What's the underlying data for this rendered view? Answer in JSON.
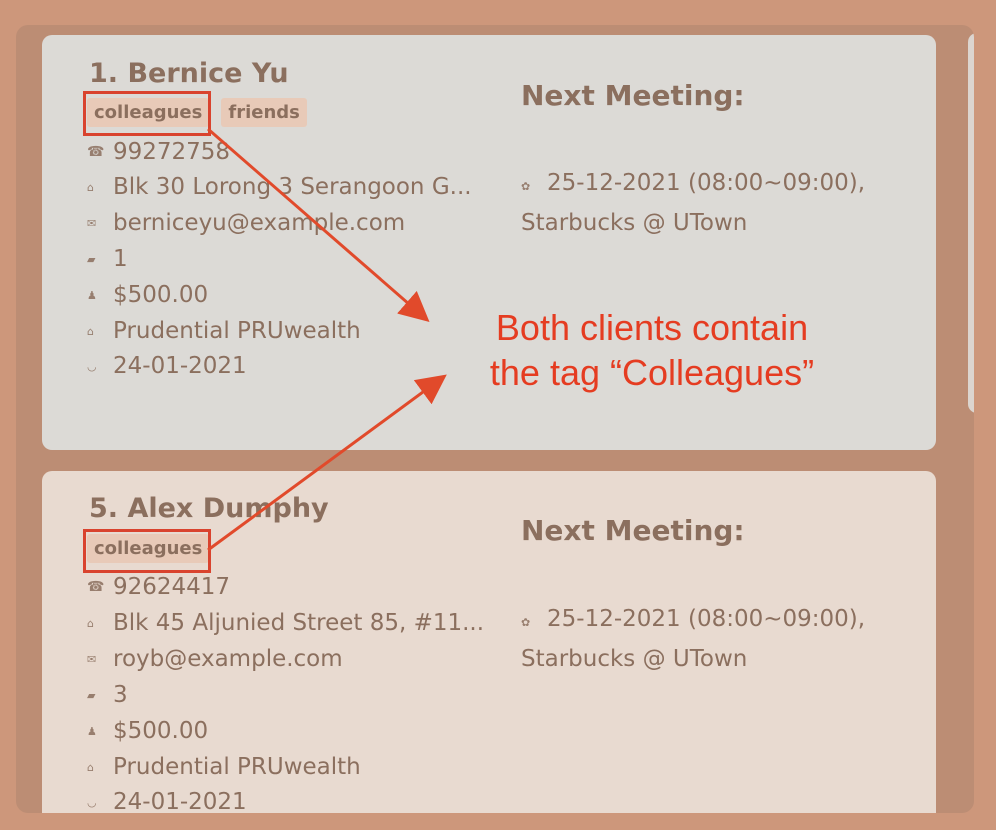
{
  "clients": [
    {
      "name": "1.  Bernice Yu",
      "tags": [
        "colleagues",
        "friends"
      ],
      "phone": "99272758",
      "address": "Blk 30 Lorong 3 Serangoon G...",
      "email": "berniceyu@example.com",
      "risk": "1",
      "income": "$500.00",
      "plan": "Prudential PRUwealth",
      "date": "24-01-2021",
      "next_meeting_label": "Next Meeting:",
      "meeting_line1": "25-12-2021 (08:00~09:00),",
      "meeting_line2": "Starbucks @ UTown"
    },
    {
      "name": "5.  Alex Dumphy",
      "tags": [
        "colleagues"
      ],
      "phone": "92624417",
      "address": "Blk 45 Aljunied Street 85, #11...",
      "email": "royb@example.com",
      "risk": "3",
      "income": "$500.00",
      "plan": "Prudential PRUwealth",
      "date": "24-01-2021",
      "next_meeting_label": "Next Meeting:",
      "meeting_line1": "25-12-2021 (08:00~09:00),",
      "meeting_line2": "Starbucks @ UTown"
    }
  ],
  "annotation": {
    "line1": "Both clients contain",
    "line2": "the tag “Colleagues”",
    "color": "#e53c21"
  },
  "icons": {
    "phone": "phone-icon",
    "address": "house-icon",
    "email": "mail-icon",
    "risk": "chart-icon",
    "income": "money-bag-icon",
    "plan": "bank-icon",
    "date": "calendar-icon",
    "meeting": "location-icon"
  }
}
